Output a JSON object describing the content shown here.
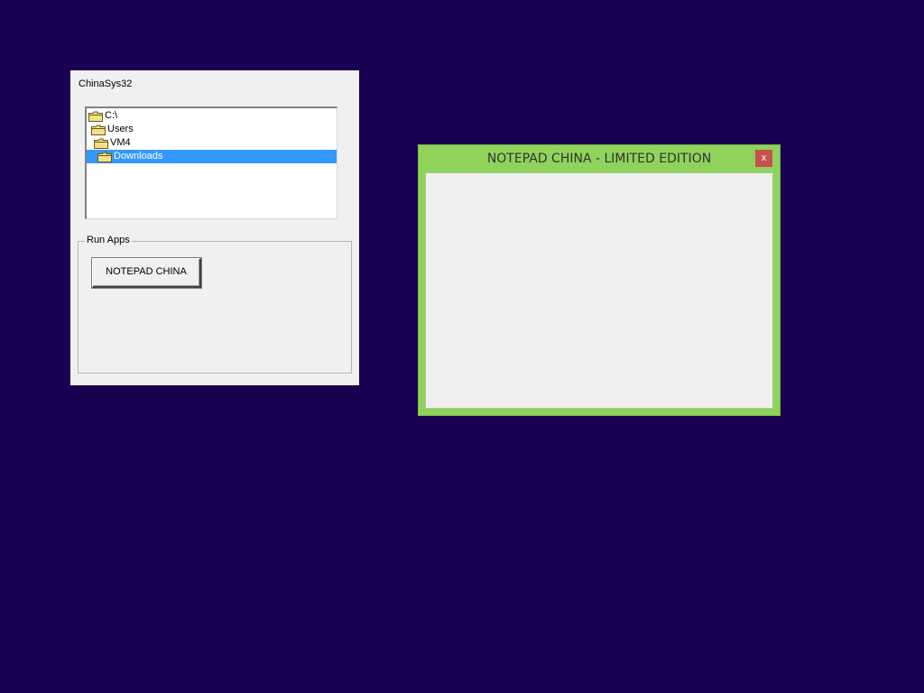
{
  "sys_window": {
    "title": "ChinaSys32",
    "tree": [
      {
        "label": "C:\\",
        "selected": false
      },
      {
        "label": "Users",
        "selected": false
      },
      {
        "label": "VM4",
        "selected": false
      },
      {
        "label": "Downloads",
        "selected": true
      }
    ],
    "group_label": "Run Apps",
    "button_label": "NOTEPAD CHINA"
  },
  "notepad_window": {
    "title": "NOTEPAD CHINA - LIMITED EDITION",
    "close_label": "x",
    "content": ""
  },
  "colors": {
    "desktop": "#1a0050",
    "notepad_frame": "#8fd35b",
    "close_button": "#c75050",
    "selection": "#3399ff"
  },
  "icons": [
    "folder-icon",
    "close-icon"
  ]
}
